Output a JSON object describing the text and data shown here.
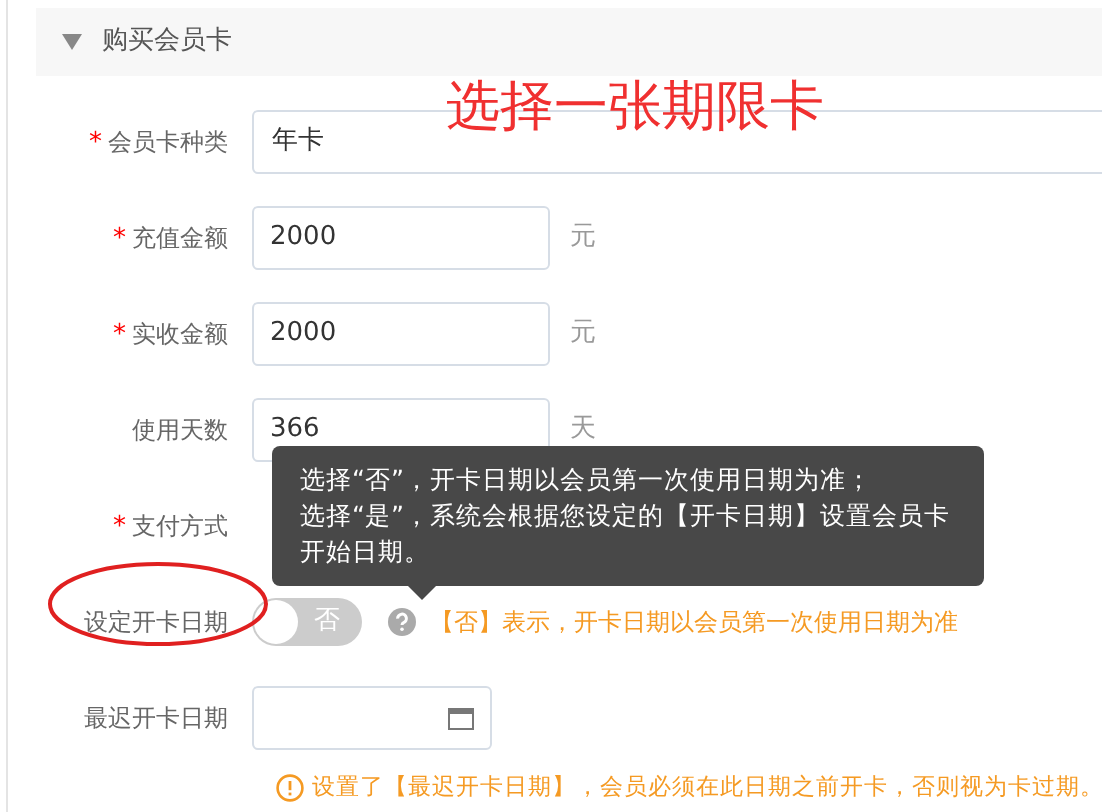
{
  "section": {
    "title": "购买会员卡",
    "expanded": true
  },
  "annotation": "选择一张期限卡",
  "fields": [
    {
      "kind": "select",
      "label": "会员卡种类",
      "required_mark": "*",
      "value": "年卡"
    },
    {
      "kind": "text",
      "label": "充值金额",
      "required_mark": "*",
      "value": "2000",
      "unit": "元"
    },
    {
      "kind": "text",
      "label": "实收金额",
      "required_mark": "*",
      "value": "2000",
      "unit": "元"
    },
    {
      "kind": "text",
      "label": "使用天数",
      "value": "366",
      "unit": "天"
    },
    {
      "kind": "radio",
      "label": "支付方式",
      "required_mark": "*"
    },
    {
      "kind": "switch",
      "label": "设定开卡日期",
      "circled": true,
      "on": false,
      "switch_text": "否",
      "hint": "【否】表示，开卡日期以会员第一次使用日期为准",
      "tooltip": [
        "选择“否”，开卡日期以会员第一次使用日期为准；",
        "选择“是”，系统会根据您设定的【开卡日期】设置会员卡开始日期。"
      ]
    },
    {
      "kind": "date",
      "label": "最迟开卡日期",
      "warning": "设置了【最迟开卡日期】，会员必须在此日期之前开卡，否则视为卡过期。"
    }
  ]
}
